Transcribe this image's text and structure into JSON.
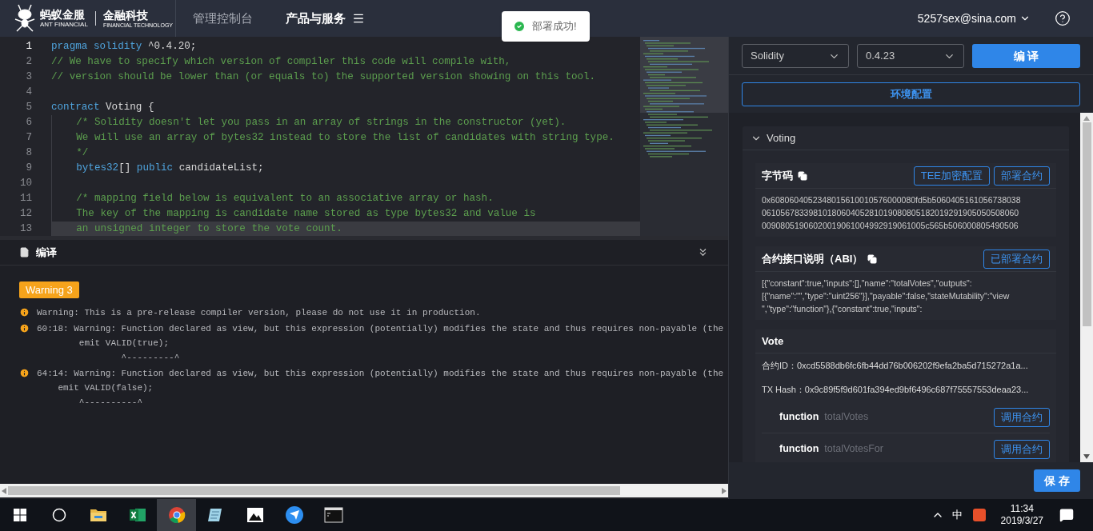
{
  "header": {
    "logo": {
      "name": "蚂蚁金服",
      "sub": "ANT FINANCIAL",
      "product": "金融科技",
      "product_sub": "FINANCIAL TECHNOLOGY"
    },
    "nav": [
      {
        "label": "管理控制台",
        "selected": false
      },
      {
        "label": "产品与服务",
        "selected": true
      }
    ],
    "user": {
      "email": "5257sex@sina.com"
    }
  },
  "toast": {
    "text": "部署成功!"
  },
  "editor": {
    "lines": [
      {
        "number": "1",
        "active": true,
        "highlighted": false,
        "tokens": [
          {
            "kind": "keyword",
            "text": "pragma solidity"
          },
          {
            "kind": "plain",
            "text": " ^0.4.20;"
          }
        ]
      },
      {
        "number": "2",
        "active": false,
        "highlighted": false,
        "tokens": [
          {
            "kind": "comment",
            "text": "// We have to specify which version of compiler this code will compile with,"
          }
        ]
      },
      {
        "number": "3",
        "active": false,
        "highlighted": false,
        "tokens": [
          {
            "kind": "comment",
            "text": "// version should be lower than (or equals to) the supported version showing on this tool."
          }
        ]
      },
      {
        "number": "4",
        "active": false,
        "highlighted": false
      },
      {
        "number": "5",
        "active": false,
        "highlighted": false,
        "tokens": [
          {
            "kind": "keyword",
            "text": "contract"
          },
          {
            "kind": "plain",
            "text": " Voting {"
          }
        ]
      },
      {
        "number": "6",
        "active": false,
        "highlighted": false,
        "tokens": [
          {
            "kind": "comment",
            "text": "    /* Solidity doesn't let you pass in an array of strings in the constructor (yet)."
          }
        ]
      },
      {
        "number": "7",
        "active": false,
        "highlighted": false,
        "tokens": [
          {
            "kind": "comment",
            "text": "    We will use an array of bytes32 instead to store the list of candidates with string type."
          }
        ]
      },
      {
        "number": "8",
        "active": false,
        "highlighted": false,
        "tokens": [
          {
            "kind": "comment",
            "text": "    */"
          }
        ]
      },
      {
        "number": "9",
        "active": false,
        "highlighted": false,
        "tokens": [
          {
            "kind": "keyword",
            "text": "    bytes32"
          },
          {
            "kind": "plain",
            "text": "[] "
          },
          {
            "kind": "keyword",
            "text": "public"
          },
          {
            "kind": "plain",
            "text": " candidateList;"
          }
        ]
      },
      {
        "number": "10",
        "active": false,
        "highlighted": false
      },
      {
        "number": "11",
        "active": false,
        "highlighted": false,
        "tokens": [
          {
            "kind": "comment",
            "text": "    /* mapping field below is equivalent to an associative array or hash."
          }
        ]
      },
      {
        "number": "12",
        "active": false,
        "highlighted": false,
        "tokens": [
          {
            "kind": "comment",
            "text": "    The key of the mapping is candidate name stored as type bytes32 and value is"
          }
        ]
      },
      {
        "number": "13",
        "active": false,
        "highlighted": true,
        "tokens": [
          {
            "kind": "comment",
            "text": "    an unsigned integer to store the vote count."
          }
        ]
      }
    ]
  },
  "compile_panel": {
    "title": "编译",
    "badge": "Warning 3",
    "messages": [
      {
        "lines": [
          "Warning: This is a pre-release compiler version, please do not use it in production."
        ]
      },
      {
        "lines": [
          "60:18: Warning: Function declared as view, but this expression (potentially) modifies the state and thus requires non-payable (the",
          "        emit VALID(true);",
          "                ^---------^"
        ]
      },
      {
        "lines": [
          "64:14: Warning: Function declared as view, but this expression (potentially) modifies the state and thus requires non-payable (the",
          "    emit VALID(false);",
          "        ^----------^"
        ]
      }
    ]
  },
  "side_panel": {
    "language": "Solidity",
    "version": "0.4.23",
    "compile_button": "编 译",
    "env_button": "环境配置",
    "contract": {
      "name": "Voting",
      "expanded": true,
      "bytecode": {
        "title": "字节码",
        "buttons": [
          "TEE加密配置",
          "部署合约"
        ],
        "lines": [
          "0x6080604052348015610010576000080fd5b5060405161056738038",
          "0610567833981018060405281019080805182019291905050508060",
          "00908051906020019061004992919061005c565b506000805490506"
        ]
      },
      "abi": {
        "title": "合约接口说明（ABI）",
        "button": "已部署合约",
        "lines": [
          "[{\"constant\":true,\"inputs\":[],\"name\":\"totalVotes\",\"outputs\":",
          "[{\"name\":\"\",\"type\":\"uint256\"}],\"payable\":false,\"stateMutability\":\"view",
          "\",\"type\":\"function\"},{\"constant\":true,\"inputs\":"
        ]
      },
      "deployed": {
        "title": "Vote",
        "fields": [
          {
            "label": "合约ID：",
            "value": "0xcd5588db6fc6fb44dd76b006202f9efa2ba5d715272a1a..."
          },
          {
            "label": "TX Hash：",
            "value": "0x9c89f5f9d601fa394ed9bf6496c687f75557553deaa23..."
          }
        ],
        "functions": [
          {
            "keyword": "function",
            "name": "totalVotes",
            "button": "调用合约"
          },
          {
            "keyword": "function",
            "name": "totalVotesFor",
            "button": "调用合约"
          }
        ]
      }
    },
    "save_button": "保 存"
  },
  "taskbar": {
    "apps": [
      {
        "kind": "start",
        "selected": false
      },
      {
        "kind": "search",
        "selected": false
      },
      {
        "kind": "folder",
        "selected": false
      },
      {
        "kind": "excel",
        "selected": false
      },
      {
        "kind": "chrome",
        "selected": true
      },
      {
        "kind": "notepad",
        "selected": false
      },
      {
        "kind": "photos",
        "selected": false
      },
      {
        "kind": "bird",
        "selected": false
      },
      {
        "kind": "terminal",
        "selected": false
      }
    ],
    "ime": "中",
    "time": "11:34",
    "date": "2019/3/27"
  }
}
